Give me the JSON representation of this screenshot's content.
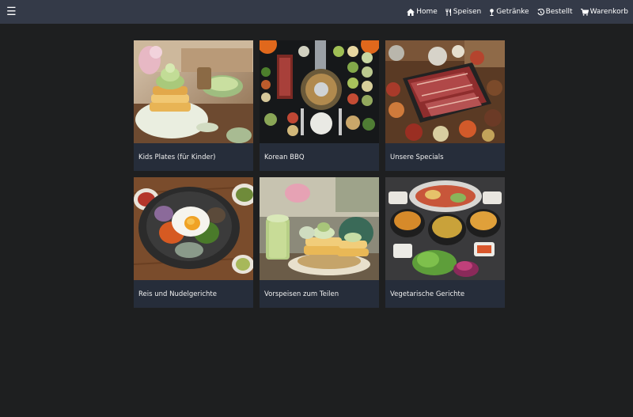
{
  "nav": {
    "links": [
      {
        "label": "Home",
        "icon": "home-icon"
      },
      {
        "label": "Speisen",
        "icon": "utensils-icon"
      },
      {
        "label": "Getränke",
        "icon": "drink-icon"
      },
      {
        "label": "Bestellt",
        "icon": "history-icon"
      },
      {
        "label": "Warenkorb",
        "icon": "cart-icon"
      }
    ]
  },
  "categories": [
    {
      "title": "Kids Plates (für Kinder)",
      "image": "pancakes-matcha"
    },
    {
      "title": "Korean BBQ",
      "image": "korean-bbq-table"
    },
    {
      "title": "Unsere Specials",
      "image": "grilled-meat-platter"
    },
    {
      "title": "Reis und Nudelgerichte",
      "image": "bibimbap-bowl"
    },
    {
      "title": "Vorspeisen zum Teilen",
      "image": "pancakes-cafe"
    },
    {
      "title": "Vegetarische Gerichte",
      "image": "vegetable-stews"
    }
  ],
  "colors": {
    "navbar": "#343a48",
    "background": "#1e1f20",
    "card": "#262d3a"
  }
}
